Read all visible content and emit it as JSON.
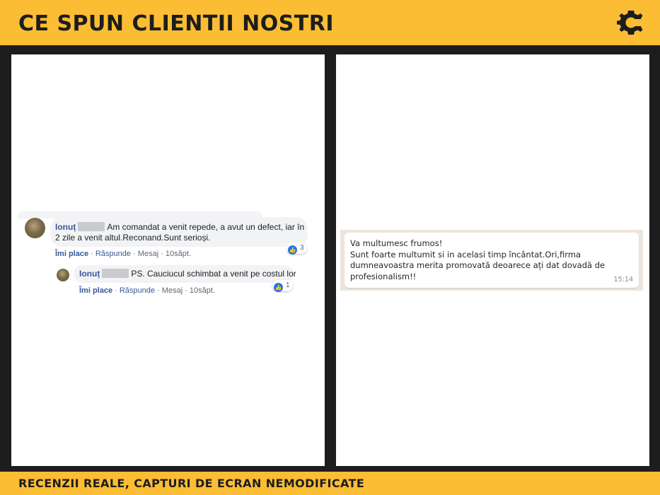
{
  "header": {
    "title": "CE SPUN CLIENTII NOSTRI",
    "logo": "c-gear-logo"
  },
  "footer": {
    "text": "RECENZII REALE, CAPTURI DE ECRAN NEMODIFICATE"
  },
  "colors": {
    "accent": "#fbbd33",
    "background": "#1d1d1d",
    "facebook_link": "#385898",
    "like_blue": "#1877f2"
  },
  "review_facebook": {
    "comment": {
      "author": "Ionuț",
      "text": "Am comandat a venit repede, a avut un defect, iar în 2 zile a venit altul.Reconand.Sunt serioși.",
      "like": "Îmi place",
      "reply": "Răspunde",
      "message": "Mesaj",
      "time": "10săpt.",
      "reactions": "3"
    },
    "reply": {
      "author": "Ionuț",
      "text": "PS. Cauciucul schimbat a venit pe costul lor",
      "like": "Îmi place",
      "reply": "Răspunde",
      "message": "Mesaj",
      "time": "10săpt.",
      "reactions": "1"
    }
  },
  "review_whatsapp": {
    "lines": [
      "Va multumesc frumos!",
      "Sunt foarte multumit si in acelasi timp încântat.Ori,firma",
      "dumneavoastra merita promovată deoarece ați dat dovadă de",
      "profesionalism!!"
    ],
    "time": "15:14"
  }
}
